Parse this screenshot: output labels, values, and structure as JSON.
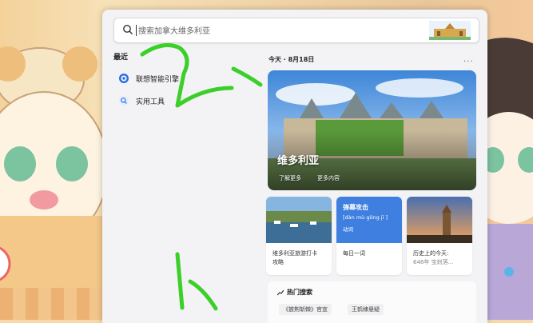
{
  "search": {
    "placeholder": "搜索加拿大维多利亚"
  },
  "sidebar": {
    "title": "最近",
    "items": [
      {
        "label": "联想智能引擎",
        "icon": "lenovo-engine-icon"
      },
      {
        "label": "实用工具",
        "icon": "tools-search-icon"
      }
    ]
  },
  "main": {
    "today_label": "今天 · 8月18日",
    "more_label": "···",
    "hero": {
      "title": "维多利亚",
      "link_learn": "了解更多",
      "link_more": "更多内容"
    },
    "cards": [
      {
        "caption_line1": "维多利亚旅游打卡",
        "caption_line2": "攻略"
      },
      {
        "word": "弹幕攻击",
        "pinyin": "[dàn mù gōng jī ]",
        "type": "动词",
        "caption_line1": "每日一词"
      },
      {
        "caption_line1": "历史上的今天:",
        "caption_line2": "648年 宝刹落..."
      }
    ],
    "hot": {
      "title": "热门搜索",
      "tags": [
        "《披荆斩棘》官宣",
        "王鹤棣悬疑"
      ]
    }
  },
  "colors": {
    "accent": "#3f7fe0",
    "panel_bg": "#f3f3f5",
    "annotation": "#3ccf2a"
  }
}
